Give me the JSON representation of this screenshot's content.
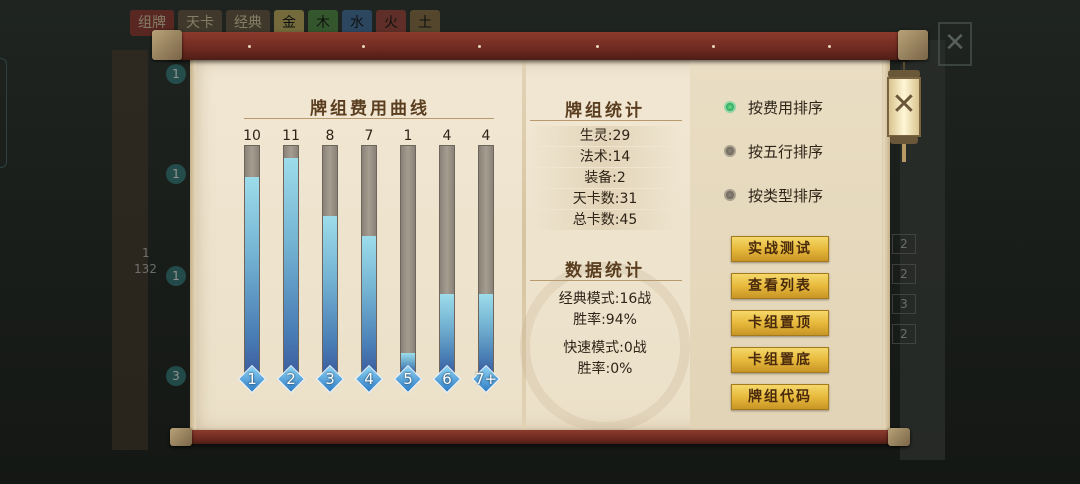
{
  "background": {
    "tabs": [
      "组牌",
      "天卡",
      "经典"
    ],
    "elements": [
      {
        "label": "金",
        "color": "#c8b15a"
      },
      {
        "label": "木",
        "color": "#4a8a3a"
      },
      {
        "label": "水",
        "color": "#3a6aa0"
      },
      {
        "label": "火",
        "color": "#a03a30"
      },
      {
        "label": "土",
        "color": "#8a6a3a"
      }
    ],
    "left_badges": [
      "1",
      "1",
      "1",
      "3"
    ],
    "left_numbers": [
      "1",
      "132"
    ],
    "right_counts": [
      "2",
      "2",
      "3",
      "2"
    ]
  },
  "curve": {
    "title": "牌组费用曲线",
    "bars": [
      {
        "cost": "1",
        "count": 10
      },
      {
        "cost": "2",
        "count": 11
      },
      {
        "cost": "3",
        "count": 8
      },
      {
        "cost": "4",
        "count": 7
      },
      {
        "cost": "5",
        "count": 1
      },
      {
        "cost": "6",
        "count": 4
      },
      {
        "cost": "7+",
        "count": 4
      }
    ],
    "max_count": 11
  },
  "deck_stats": {
    "title": "牌组统计",
    "rows": [
      "生灵:29",
      "法术:14",
      "装备:2",
      "天卡数:31",
      "总卡数:45"
    ]
  },
  "data_stats": {
    "title": "数据统计",
    "classic_mode": "经典模式:16战",
    "classic_winrate": "胜率:94%",
    "quick_mode": "快速模式:0战",
    "quick_winrate": "胜率:0%"
  },
  "sort": {
    "options": [
      {
        "label": "按费用排序",
        "selected": true
      },
      {
        "label": "按五行排序",
        "selected": false
      },
      {
        "label": "按类型排序",
        "selected": false
      }
    ]
  },
  "buttons": {
    "battle_test": "实战测试",
    "view_list": "查看列表",
    "deck_top": "卡组置顶",
    "deck_bottom": "卡组置底",
    "deck_code": "牌组代码"
  },
  "colors": {
    "bar_fill_top": "#9ddcea",
    "bar_fill_bottom": "#3d5fa0",
    "scroll_rod": "#7a3024",
    "parchment": "#efe5d0",
    "gold_button": "#e7b93c",
    "selected_radio": "#2fa35c"
  }
}
